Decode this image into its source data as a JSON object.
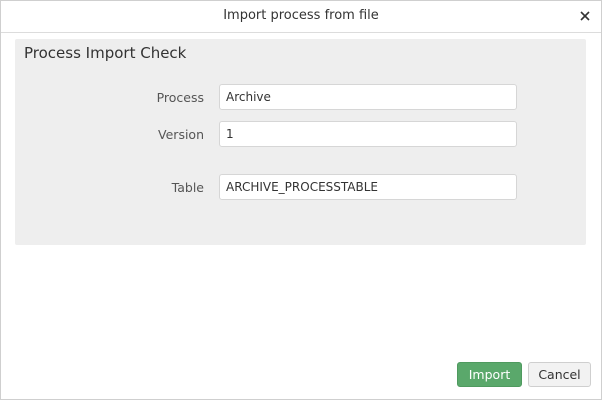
{
  "dialog": {
    "title": "Import process from file",
    "close_icon": "close-icon"
  },
  "panel": {
    "heading": "Process Import Check",
    "fields": [
      {
        "label": "Process",
        "value": "Archive"
      },
      {
        "label": "Version",
        "value": "1"
      },
      {
        "label": "Table",
        "value": "ARCHIVE_PROCESSTABLE"
      }
    ]
  },
  "actions": {
    "import_label": "Import",
    "cancel_label": "Cancel"
  },
  "colors": {
    "primary": "#5aa86b",
    "panel_bg": "#eeeeee"
  }
}
